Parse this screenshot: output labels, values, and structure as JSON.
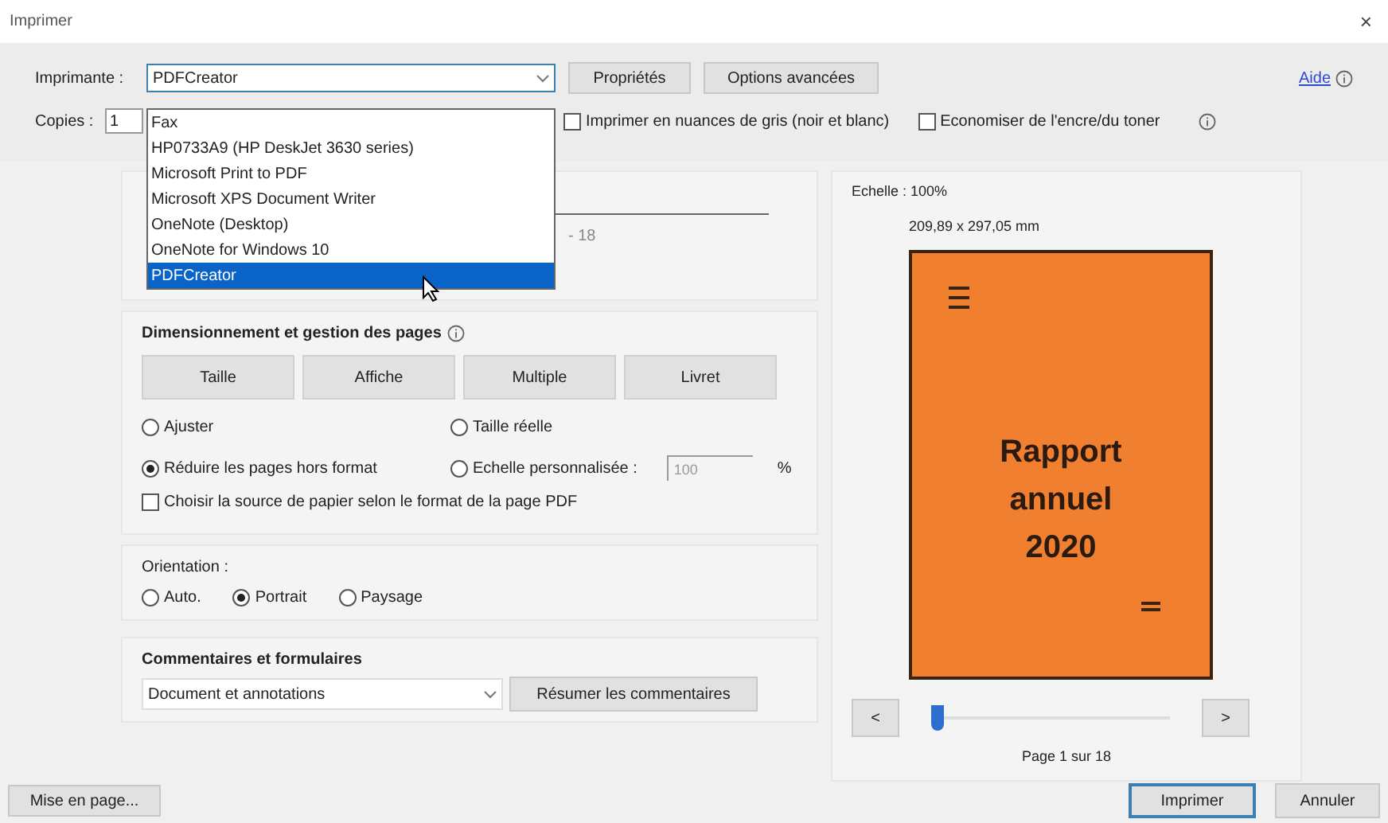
{
  "window": {
    "title": "Imprimer",
    "close": "×"
  },
  "printer": {
    "label": "Imprimante :",
    "value": "PDFCreator",
    "expanded": true,
    "options": [
      {
        "label": "Fax",
        "selected": false
      },
      {
        "label": "HP0733A9 (HP DeskJet 3630 series)",
        "selected": false
      },
      {
        "label": "Microsoft Print to PDF",
        "selected": false
      },
      {
        "label": "Microsoft XPS Document Writer",
        "selected": false
      },
      {
        "label": "OneNote (Desktop)",
        "selected": false
      },
      {
        "label": "OneNote for Windows 10",
        "selected": false
      },
      {
        "label": "PDFCreator",
        "selected": true
      }
    ]
  },
  "top_buttons": [
    "Propriétés",
    "Options avancées"
  ],
  "help": {
    "label": "Aide"
  },
  "copies": {
    "label": "Copies :",
    "value": "1"
  },
  "options": [
    {
      "label": "Imprimer en nuances de gris (noir et blanc)",
      "checked": false
    },
    {
      "label": "Economiser de l'encre/du toner",
      "checked": false
    }
  ],
  "pages_section": {
    "range_fragment": "- 18"
  },
  "sizing": {
    "title": "Dimensionnement et gestion des pages",
    "tabs": [
      {
        "label": "Taille",
        "selected": false
      },
      {
        "label": "Affiche",
        "selected": false
      },
      {
        "label": "Multiple",
        "selected": false
      },
      {
        "label": "Livret",
        "selected": false
      }
    ],
    "radios": [
      {
        "label": "Ajuster",
        "selected": false
      },
      {
        "label": "Taille réelle",
        "selected": false
      },
      {
        "label": "Réduire les pages hors format",
        "selected": true
      },
      {
        "label": "Echelle personnalisée :",
        "selected": false
      }
    ],
    "scale": {
      "placeholder": "100",
      "unit": "%"
    },
    "paper_source": {
      "label": "Choisir la source de papier selon le format de la page PDF",
      "checked": false
    }
  },
  "orientation": {
    "title": "Orientation :",
    "options": [
      {
        "label": "Auto.",
        "selected": false
      },
      {
        "label": "Portrait",
        "selected": true
      },
      {
        "label": "Paysage",
        "selected": false
      }
    ]
  },
  "comments": {
    "title": "Commentaires et formulaires",
    "value": "Document et annotations",
    "button": "Résumer les commentaires"
  },
  "preview": {
    "scale": "Echelle : 100%",
    "size": "209,89 x 297,05 mm",
    "cover_title": [
      "Rapport",
      "annuel",
      "2020"
    ],
    "prev": "<",
    "next": ">",
    "level": 0,
    "page": "Page 1 sur 18"
  },
  "footer": {
    "setup": "Mise en page...",
    "print": "Imprimer",
    "cancel": "Annuler"
  }
}
